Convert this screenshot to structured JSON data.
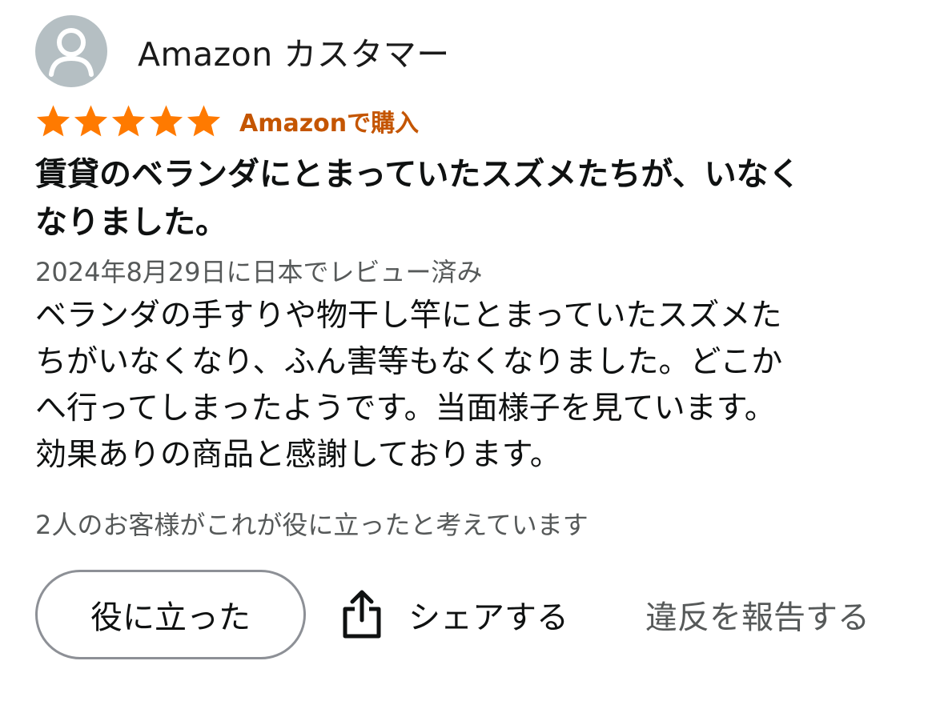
{
  "reviewer": {
    "name": "Amazon カスタマー",
    "avatar_icon": "default-user-avatar-icon"
  },
  "rating": {
    "stars": 5,
    "max_stars": 5,
    "star_color": "#ff7a00",
    "verified_label": "Amazonで購入"
  },
  "review": {
    "title_line1": "賃貸のベランダにとまっていたスズメたちが、いなく",
    "title_line2": "なりました。",
    "date": "2024年8月29日に日本でレビュー済み",
    "body_lines": [
      "ベランダの手すりや物干し竿にとまっていたスズメた",
      "ちがいなくなり、ふん害等もなくなりました。どこか",
      "へ行ってしまったようです。当面様子を見ています。",
      "効果ありの商品と感謝しております。"
    ],
    "helpful_text": "2人のお客様がこれが役に立ったと考えています"
  },
  "actions": {
    "helpful_label": "役に立った",
    "share_label": "シェアする",
    "share_icon": "share-icon",
    "report_label": "違反を報告する"
  }
}
